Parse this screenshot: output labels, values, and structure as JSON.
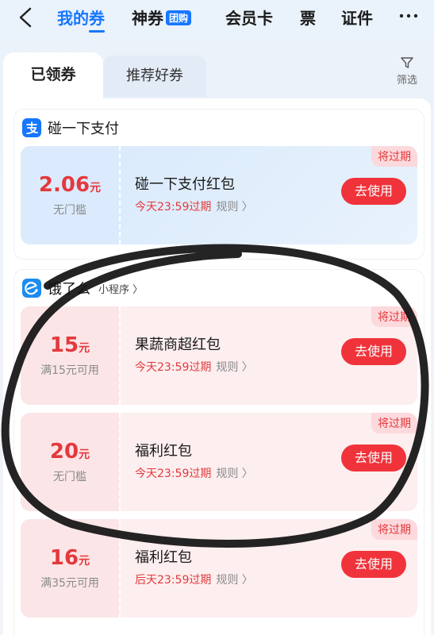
{
  "nav": {
    "tabs": [
      {
        "label": "我的券"
      },
      {
        "label": "神券",
        "badge": "团购"
      },
      {
        "label": "会员卡"
      },
      {
        "label": "票"
      },
      {
        "label": "证件"
      }
    ]
  },
  "subtabs": {
    "claimed": "已领券",
    "recommended": "推荐好券",
    "filter": "筛选"
  },
  "groups": [
    {
      "brand": "碰一下支付",
      "coupons": [
        {
          "amount": "2.06",
          "unit": "元",
          "condition": "无门槛",
          "title": "碰一下支付红包",
          "expire": "今天23:59过期",
          "rules": "规则",
          "badge": "将过期",
          "button": "去使用"
        }
      ]
    },
    {
      "brand": "饿了么",
      "tag": "小程序",
      "coupons": [
        {
          "amount": "15",
          "unit": "元",
          "condition": "满15元可用",
          "title": "果蔬商超红包",
          "expire": "今天23:59过期",
          "rules": "规则",
          "badge": "将过期",
          "button": "去使用"
        },
        {
          "amount": "20",
          "unit": "元",
          "condition": "无门槛",
          "title": "福利红包",
          "expire": "今天23:59过期",
          "rules": "规则",
          "badge": "将过期",
          "button": "去使用"
        },
        {
          "amount": "16",
          "unit": "元",
          "condition": "满35元可用",
          "title": "福利红包",
          "expire": "后天23:59过期",
          "rules": "规则",
          "badge": "将过期",
          "button": "去使用"
        }
      ]
    }
  ],
  "colors": {
    "accent": "#1677ff",
    "danger": "#e4393c",
    "button": "#f0333b"
  }
}
